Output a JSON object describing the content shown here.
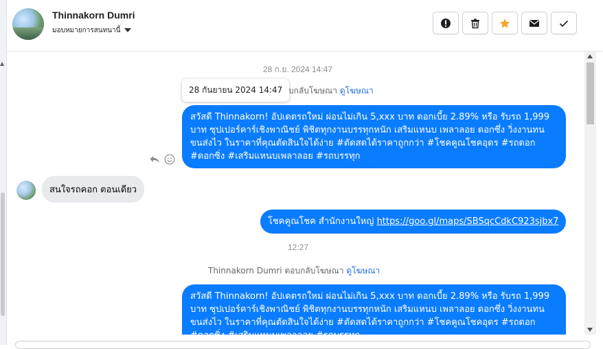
{
  "contact": {
    "name": "Thinnakorn Dumri",
    "assign_label": "มอบหมายการสนทนานี้"
  },
  "toolbar": {
    "items": [
      {
        "name": "report-button",
        "icon": "exclamation-circle-icon"
      },
      {
        "name": "delete-button",
        "icon": "trash-icon"
      },
      {
        "name": "star-button",
        "icon": "star-icon",
        "color": "#f5a623"
      },
      {
        "name": "email-button",
        "icon": "envelope-icon"
      },
      {
        "name": "done-button",
        "icon": "checkmark-icon"
      }
    ]
  },
  "conversation": {
    "timestamp1": "28 ก.ย. 2024 14:47",
    "tooltip": "28 กันยายน 2024 14:47",
    "reply_meta1": {
      "text": "ตอบกลับโฆษณา",
      "link": "ดูโฆษณา"
    },
    "message1": "สวัสดี Thinnakorn! อัปเดตรถใหม่ ผ่อนไม่เกิน 5,xxx บาท ดอกเบี้ย 2.89% หรือ รับรถ 1,999 บาท ซุปเปอร์คาร์เชิงพาณิชย์ พิชิตทุกงานบรรทุกหนัก เสริมแหนบ เพลาลอย ดอกซึ่ง วิ่งงานทน ขนส่งไว ในราคาที่คุณตัดสินใจได้ง่าย #ตัดสดได้ราคาถูกกว่า #โชคคูณโชคอุดร #รถดอก #ดอกซิ่ง #เสริมแหนบเพลาลอย #รถบรรทุก",
    "incoming1": "สนใจรถคอก ตอนเดียว",
    "message2_text": "โชคคูณโชค สำนักงานใหญ่",
    "message2_link": "https://goo.gl/maps/SBSqcCdkC923sjbx7",
    "timestamp2": "12:27",
    "reply_meta2": {
      "name": "Thinnakorn Dumri",
      "text": "ตอบกลับโฆษณา",
      "link": "ดูโฆษณา"
    },
    "message3": "สวัสดี Thinnakorn! อัปเดตรถใหม่ ผ่อนไม่เกิน 5,xxx บาท ดอกเบี้ย 2.89% หรือ รับรถ 1,999 บาท ซุปเปอร์คาร์เชิงพาณิชย์ พิชิตทุกงานบรรทุกหนัก เสริมแหนบ เพลาลอย ดอกซึ่ง วิ่งงานทน ขนส่งไว ในราคาที่คุณตัดสินใจได้ง่าย #ตัดสดได้ราคาถูกกว่า #โชคคูณโชคอุดร #รถดอก #ดอกซิ่ง #เสริมแหนบเพลาลอย #รถบรรทุก"
  },
  "colors": {
    "bubble_out": "#0a7cff",
    "bubble_in": "#e9eaee",
    "link": "#216fdb",
    "star": "#f5a623"
  }
}
